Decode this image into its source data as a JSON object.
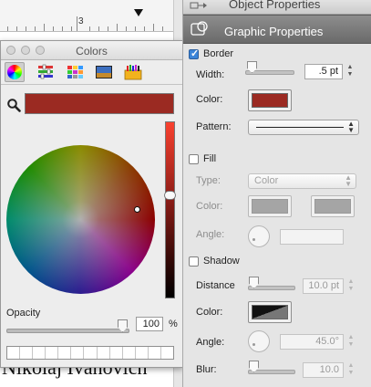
{
  "document": {
    "ruler_label": "3",
    "body_text": "Nikolaj Ivanovich"
  },
  "colors_panel": {
    "title": "Colors",
    "toolbar_icons": [
      "color-wheel-icon",
      "color-sliders-icon",
      "color-palettes-icon",
      "image-palettes-icon",
      "crayons-icon"
    ],
    "current_color": "#9b2a22",
    "opacity_label": "Opacity",
    "opacity_value": "100",
    "opacity_unit": "%",
    "opacity_fraction": 1.0,
    "swatch_slots": 13
  },
  "inspector": {
    "object_properties_label": "Object Properties",
    "graphic_properties_label": "Graphic Properties",
    "border": {
      "label": "Border",
      "checked": true,
      "width_label": "Width:",
      "width_value": ".5 pt",
      "color_label": "Color:",
      "color": "#9b2a22",
      "pattern_label": "Pattern:"
    },
    "fill": {
      "label": "Fill",
      "checked": false,
      "type_label": "Type:",
      "type_value": "Color",
      "color_label": "Color:",
      "angle_label": "Angle:"
    },
    "shadow": {
      "label": "Shadow",
      "checked": false,
      "distance_label": "Distance",
      "distance_value": "10.0 pt",
      "color_label": "Color:",
      "angle_label": "Angle:",
      "angle_value": "45.0°",
      "blur_label": "Blur:",
      "blur_value": "10.0"
    }
  }
}
